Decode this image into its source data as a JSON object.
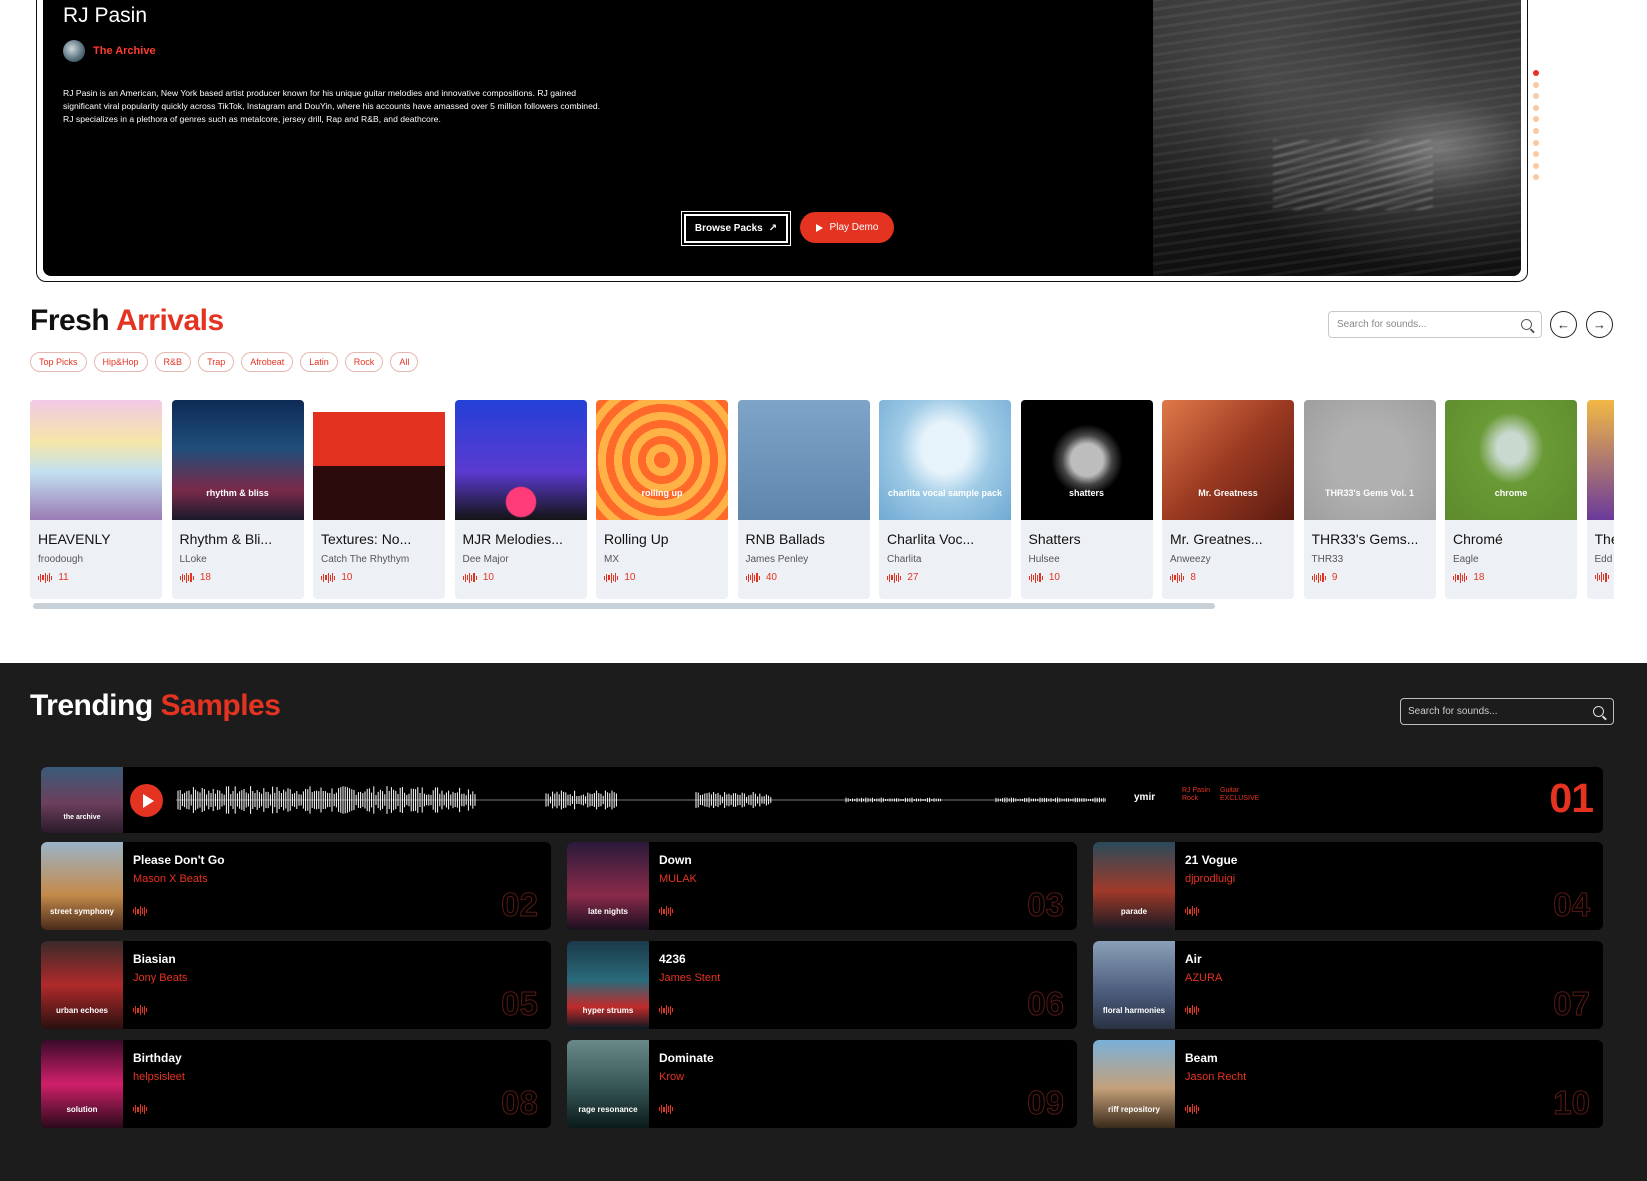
{
  "hero": {
    "title": "RJ Pasin",
    "archive_label": "The Archive",
    "bio": "RJ Pasin is an American, New York based artist producer known for his unique guitar melodies and innovative compositions. RJ gained significant viral popularity quickly across TikTok, Instagram and DouYin, where his accounts have amassed over 5 million followers combined. RJ specializes in a plethora of genres such as metalcore, jersey drill, Rap and R&B, and deathcore.",
    "browse_label": "Browse Packs",
    "browse_icon": "↗",
    "play_label": "Play Demo",
    "slide_count": 10,
    "active_slide": 1
  },
  "fresh": {
    "title_main": "Fresh",
    "title_accent": "Arrivals",
    "search_placeholder": "Search for sounds...",
    "prev_icon": "←",
    "next_icon": "→",
    "chips": [
      "Top Picks",
      "Hip&Hop",
      "R&B",
      "Trap",
      "Afrobeat",
      "Latin",
      "Rock",
      "All"
    ],
    "cards": [
      {
        "title": "HEAVENLY",
        "artist": "froodough",
        "count": "11",
        "art_text": ""
      },
      {
        "title": "Rhythm & Bli...",
        "artist": "LLoke",
        "count": "18",
        "art_text": "rhythm & bliss"
      },
      {
        "title": "Textures: No...",
        "artist": "Catch The Rhythym",
        "count": "10",
        "art_text": ""
      },
      {
        "title": "MJR Melodies...",
        "artist": "Dee Major",
        "count": "10",
        "art_text": ""
      },
      {
        "title": "Rolling Up",
        "artist": "MX",
        "count": "10",
        "art_text": "rolling up"
      },
      {
        "title": "RNB Ballads",
        "artist": "James Penley",
        "count": "40",
        "art_text": ""
      },
      {
        "title": "Charlita Voc...",
        "artist": "Charlita",
        "count": "27",
        "art_text": "charlita vocal sample pack"
      },
      {
        "title": "Shatters",
        "artist": "Hulsee",
        "count": "10",
        "art_text": "shatters"
      },
      {
        "title": "Mr. Greatnes...",
        "artist": "Anweezy",
        "count": "8",
        "art_text": "Mr. Greatness"
      },
      {
        "title": "THR33's Gems...",
        "artist": "THR33",
        "count": "9",
        "art_text": "THR33's Gems Vol. 1"
      },
      {
        "title": "Chromé",
        "artist": "Eagle",
        "count": "18",
        "art_text": "chrome"
      },
      {
        "title": "The",
        "artist": "Edd",
        "count": "",
        "art_text": ""
      }
    ]
  },
  "trending": {
    "title_main": "Trending",
    "title_accent": "Samples",
    "search_placeholder": "Search for sounds...",
    "featured": {
      "art_text": "the archive",
      "artist": "ymir",
      "tags": [
        "RJ Pasin",
        "Guitar",
        "Rock",
        "EXCLUSIVE"
      ],
      "rank": "01"
    },
    "rows": [
      {
        "title": "Please Don't Go",
        "artist": "Mason X Beats",
        "rank": "02",
        "art_text": "street symphony"
      },
      {
        "title": "Down",
        "artist": "MULAK",
        "rank": "03",
        "art_text": "late nights"
      },
      {
        "title": "21 Vogue",
        "artist": "djprodluigi",
        "rank": "04",
        "art_text": "parade"
      },
      {
        "title": "Biasian",
        "artist": "Jony Beats",
        "rank": "05",
        "art_text": "urban echoes"
      },
      {
        "title": "4236",
        "artist": "James Stent",
        "rank": "06",
        "art_text": "hyper strums"
      },
      {
        "title": "Air",
        "artist": "AZURA",
        "rank": "07",
        "art_text": "floral harmonies"
      },
      {
        "title": "Birthday",
        "artist": "helpsisleet",
        "rank": "08",
        "art_text": "solution"
      },
      {
        "title": "Dominate",
        "artist": "Krow",
        "rank": "09",
        "art_text": "rage resonance"
      },
      {
        "title": "Beam",
        "artist": "Jason Recht",
        "rank": "10",
        "art_text": "riff repository"
      }
    ]
  },
  "colors": {
    "accent": "#e53322",
    "dark_bg": "#1c1c1c",
    "card_bg": "#edf1f5"
  }
}
